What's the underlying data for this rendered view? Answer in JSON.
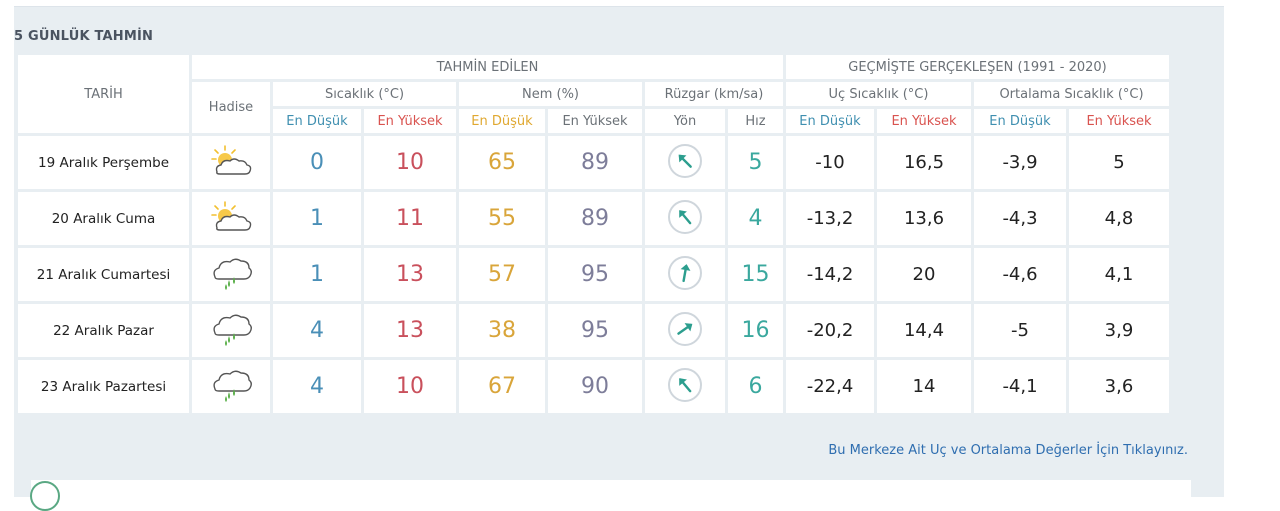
{
  "section_title": "5 GÜNLÜK TAHMİN",
  "header": {
    "date": "TARİH",
    "forecast_group": "TAHMİN EDİLEN",
    "history_group": "GEÇMİŞTE GERÇEKLEŞEN (1991 - 2020)",
    "event": "Hadise",
    "temperature": "Sıcaklık (°C)",
    "humidity": "Nem (%)",
    "wind": "Rüzgar (km/sa)",
    "extreme_temp": "Uç Sıcaklık (°C)",
    "avg_temp": "Ortalama Sıcaklık (°C)",
    "low": "En Düşük",
    "high": "En Yüksek",
    "direction": "Yön",
    "speed": "Hız"
  },
  "rows": [
    {
      "date": "19 Aralık Perşembe",
      "icon": "partly-cloudy-icon",
      "t_low": "0",
      "t_high": "10",
      "h_low": "65",
      "h_high": "89",
      "wind_dir_deg": 315,
      "wind_speed": "5",
      "ext_low": "-10",
      "ext_high": "16,5",
      "avg_low": "-3,9",
      "avg_high": "5"
    },
    {
      "date": "20 Aralık Cuma",
      "icon": "partly-cloudy-icon",
      "t_low": "1",
      "t_high": "11",
      "h_low": "55",
      "h_high": "89",
      "wind_dir_deg": 320,
      "wind_speed": "4",
      "ext_low": "-13,2",
      "ext_high": "13,6",
      "avg_low": "-4,3",
      "avg_high": "4,8"
    },
    {
      "date": "21 Aralık Cumartesi",
      "icon": "rain-cloud-icon",
      "t_low": "1",
      "t_high": "13",
      "h_low": "57",
      "h_high": "95",
      "wind_dir_deg": 10,
      "wind_speed": "15",
      "ext_low": "-14,2",
      "ext_high": "20",
      "avg_low": "-4,6",
      "avg_high": "4,1"
    },
    {
      "date": "22 Aralık Pazar",
      "icon": "rain-cloud-icon",
      "t_low": "4",
      "t_high": "13",
      "h_low": "38",
      "h_high": "95",
      "wind_dir_deg": 55,
      "wind_speed": "16",
      "ext_low": "-20,2",
      "ext_high": "14,4",
      "avg_low": "-5",
      "avg_high": "3,9"
    },
    {
      "date": "23 Aralık Pazartesi",
      "icon": "rain-cloud-icon",
      "t_low": "4",
      "t_high": "10",
      "h_low": "67",
      "h_high": "90",
      "wind_dir_deg": 320,
      "wind_speed": "6",
      "ext_low": "-22,4",
      "ext_high": "14",
      "avg_low": "-4,1",
      "avg_high": "3,6"
    }
  ],
  "footer_link": "Bu Merkeze Ait Uç ve Ortalama Değerler İçin Tıklayınız."
}
